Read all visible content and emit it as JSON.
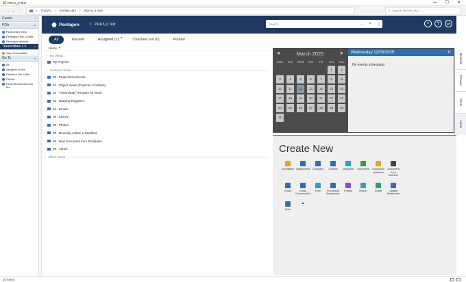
{
  "window": {
    "title": "PDA 5_0 Test",
    "min": "—",
    "max": "☐",
    "close": "✕"
  },
  "address": {
    "crumbs": [
      "This PC",
      "M-Files (M:)",
      "PDA 5_0 Test"
    ],
    "search_placeholder": "Search M-Files (M:)"
  },
  "left": {
    "create": {
      "label": "Create",
      "chevron": "›"
    },
    "pda": {
      "label": "PDA",
      "chevron": "⌄",
      "items": [
        {
          "label": "PDA Online Help",
          "color": "#3b6ea8"
        },
        {
          "label": "Pentagon Help Centre",
          "color": "#3b6ea8"
        },
        {
          "label": "Pentagon Website",
          "color": "#3b6ea8"
        }
      ]
    },
    "transmittals": {
      "label": "Transmittals 1.5",
      "chevron": "⌄",
      "items": [
        {
          "label": "View Transmittals",
          "color": "#d99a1e"
        }
      ]
    },
    "goto": {
      "label": "Go To",
      "chevron": "⌄",
      "items": [
        {
          "label": "All",
          "color": "#3b6ea8"
        },
        {
          "label": "Assigned to Me",
          "color": "#3b6ea8"
        },
        {
          "label": "Checked Out to Me",
          "color": "#3b6ea8"
        },
        {
          "label": "Pinned",
          "color": "#3b6ea8"
        },
        {
          "label": "Recently Accessed by Me",
          "color": "#3b6ea8"
        }
      ]
    }
  },
  "app": {
    "brand": "Pentagon",
    "vault": "PDA 5_0 Test",
    "search_placeholder": "Search",
    "user_initials": "CH"
  },
  "tabs": [
    {
      "label": "All"
    },
    {
      "label": "Recent"
    },
    {
      "label": "Assigned (1)"
    },
    {
      "label": "Checked out (0)"
    },
    {
      "label": "Pinned"
    }
  ],
  "list": {
    "name_col": "Name",
    "my_views_label": "My Views",
    "my_views": [
      "My Projects"
    ],
    "common_views_label": "Common Views",
    "common_views": [
      "00 - Project Documents",
      "01 - Object Views (Projects \\ Contacts)",
      "02 - Transmittals \\ Prepare for Issue",
      "03 - Drawing Registers",
      "04 - Emails",
      "05 - Library",
      "06 - Photos",
      "90 - Recently Added or Modified",
      "98 - New Document from Templates",
      "99 - Admin"
    ],
    "other_views_label": "Other Views"
  },
  "calendar": {
    "month": "March 2025",
    "prev": "◀",
    "next": "▶",
    "day_names": [
      "Mon",
      "Tue",
      "Wed",
      "Thu",
      "Fri",
      "Sat",
      "Sun"
    ],
    "leading_blanks": 5,
    "days": [
      "1",
      "2",
      "3",
      "4",
      "5",
      "6",
      "7",
      "8",
      "9",
      "10",
      "11",
      "12",
      "13",
      "14",
      "15",
      "16",
      "17",
      "18",
      "19",
      "20",
      "21",
      "22",
      "23",
      "24",
      "25",
      "26",
      "27",
      "28",
      "29",
      "30",
      "31"
    ],
    "today": "12"
  },
  "events": {
    "header": "Wednesday 12/03/2025",
    "refresh": "↻",
    "empty": "No events scheduled."
  },
  "sidetabs": [
    "Metadata",
    "Preview",
    "Filters",
    "Home"
  ],
  "create_new": {
    "title": "Create New",
    "items": [
      {
        "label": "Annotation",
        "color": "#e0a81e"
      },
      {
        "label": "Assignment",
        "color": "#2f6db5"
      },
      {
        "label": "Company",
        "color": "#2f6db5"
      },
      {
        "label": "Contact",
        "color": "#2f6db5"
      },
      {
        "label": "Discipline",
        "color": "#2aa1c7"
      },
      {
        "label": "Document",
        "color": "#3a9a4a"
      },
      {
        "label": "Document collection",
        "color": "#e0a81e"
      },
      {
        "label": "Document from Scanner",
        "color": "#444444"
      },
      {
        "label": "Email",
        "color": "#2f6db5"
      },
      {
        "label": "Email Conversation",
        "color": "#2f6db5"
      },
      {
        "label": "Form",
        "color": "#2aa1c7"
      },
      {
        "label": "Functional Breakdown",
        "color": "#2f6db5"
      },
      {
        "label": "Project",
        "color": "#8a4ac7"
      },
      {
        "label": "Report",
        "color": "#2aa1c7"
      },
      {
        "label": "Share",
        "color": "#2aa17a"
      },
      {
        "label": "Spatial Breakdown",
        "color": "#2f6db5"
      },
      {
        "label": "View",
        "color": "#3b6ea8"
      }
    ],
    "collapse": "▲"
  },
  "status": {
    "items": "20 items"
  }
}
